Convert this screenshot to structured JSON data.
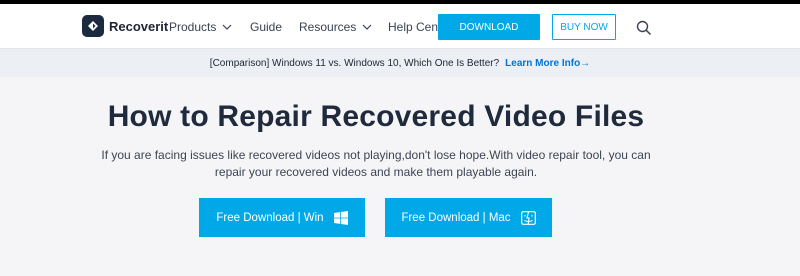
{
  "brand": {
    "name": "Recoverit"
  },
  "nav": {
    "products": "Products",
    "guide": "Guide",
    "resources": "Resources",
    "help_center": "Help Center",
    "download": "DOWNLOAD",
    "buy_now": "BUY NOW"
  },
  "promo": {
    "text": "[Comparison] Windows 11 vs. Windows 10, Which One Is Better?",
    "link": "Learn More Info→"
  },
  "hero": {
    "title": "How to Repair Recovered Video Files",
    "description": "If you are facing issues like recovered videos not playing,don't lose hope.With video repair tool, you can repair your recovered videos and make them playable again.",
    "download_win": "Free Download | Win",
    "download_mac": "Free Download | Mac"
  },
  "colors": {
    "accent": "#00a8e8",
    "link": "#0074d9",
    "title": "#1f2a3c",
    "background": "#f5f5f7"
  },
  "icons": {
    "logo": "recoverit-logo-icon",
    "chevron": "chevron-down-icon",
    "search": "search-icon",
    "windows": "windows-icon",
    "mac": "mac-finder-icon"
  }
}
